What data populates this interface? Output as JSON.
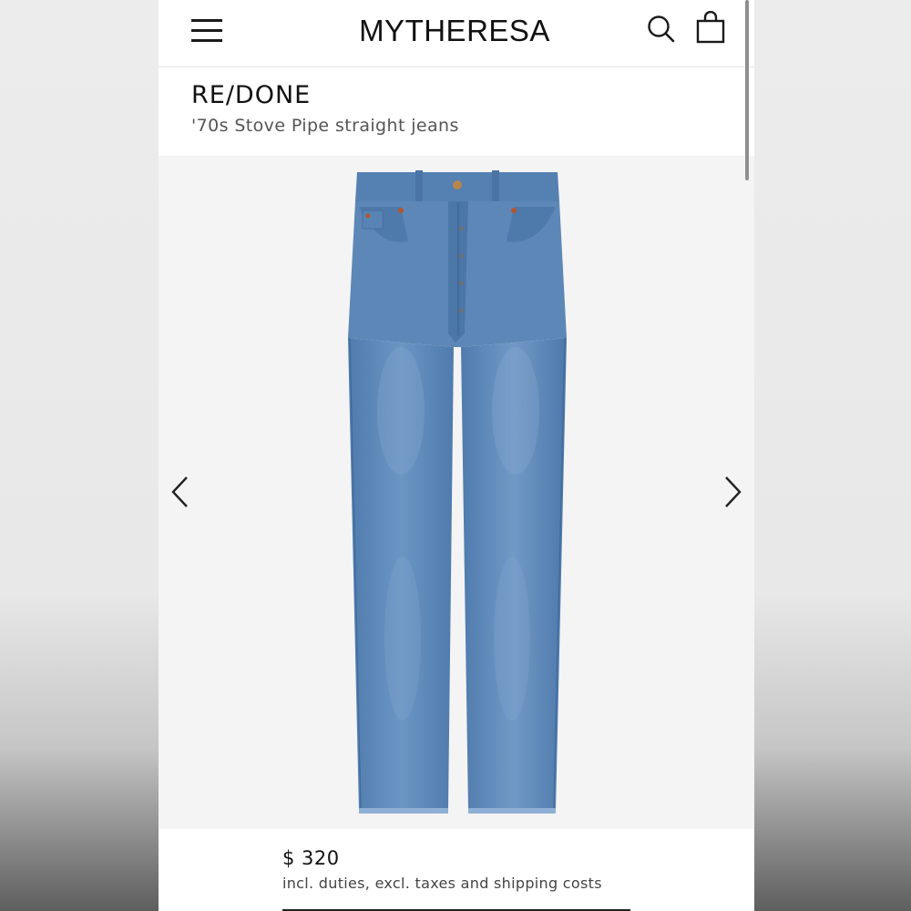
{
  "header": {
    "logo": "MYTHERESA",
    "menu_icon": "hamburger-menu-icon",
    "search_icon": "search-icon",
    "bag_icon": "shopping-bag-icon"
  },
  "product": {
    "brand": "RE/DONE",
    "name": "'70s Stove Pipe straight jeans",
    "image_icon": "jeans-product-image",
    "price": "$ 320",
    "price_note": "incl. duties, excl. taxes and shipping costs"
  },
  "carousel": {
    "prev_icon": "chevron-left-icon",
    "next_icon": "chevron-right-icon"
  },
  "colors": {
    "denim": "#5b86b5",
    "denim_light": "#7ea3cc",
    "denim_dark": "#3f6a9c",
    "background": "#f4f4f4",
    "text": "#111111"
  }
}
